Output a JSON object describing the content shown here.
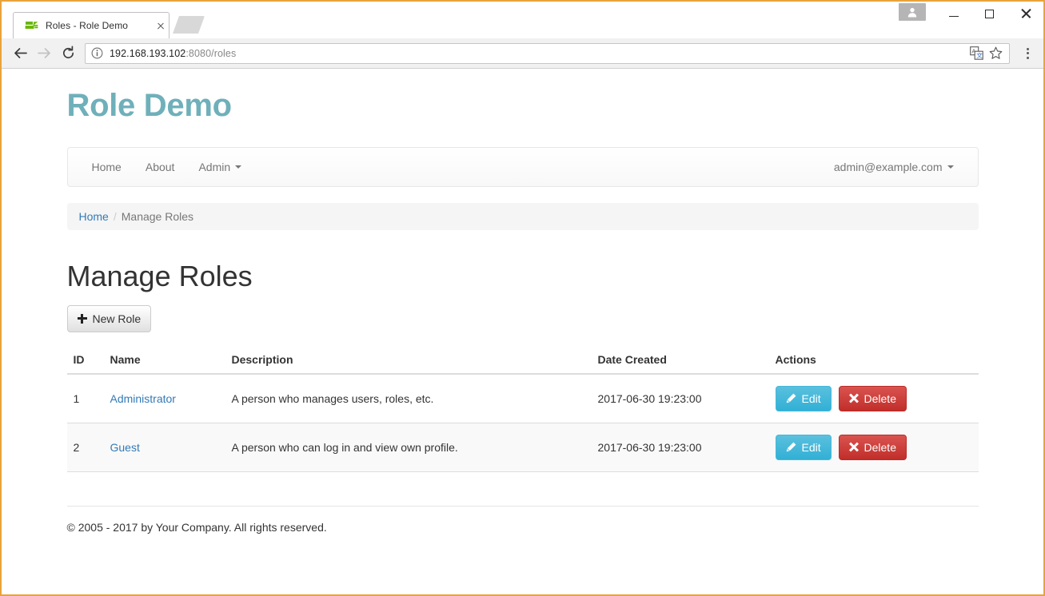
{
  "browser": {
    "tab": {
      "title": "Roles - Role Demo",
      "favicon_name": "zend-framework-favicon",
      "close_label": "Close tab"
    },
    "window_controls": {
      "profile_label": "Profile",
      "minimize_label": "Minimize",
      "maximize_label": "Maximize",
      "close_label": "Close"
    },
    "toolbar": {
      "back_label": "Back",
      "forward_label": "Forward",
      "reload_label": "Reload",
      "site_info_label": "Site information",
      "url_host": "192.168.193.102",
      "url_rest": ":8080/roles",
      "translate_label": "Translate this page",
      "bookmark_label": "Bookmark this page",
      "menu_label": "Customize and control Google Chrome"
    }
  },
  "page": {
    "brand": "Role Demo",
    "navbar": {
      "items": [
        {
          "label": "Home",
          "caret": false
        },
        {
          "label": "About",
          "caret": false
        },
        {
          "label": "Admin",
          "caret": true
        }
      ],
      "user": {
        "label": "admin@example.com",
        "caret": true
      }
    },
    "breadcrumb": {
      "home": "Home",
      "separator": "/",
      "current": "Manage Roles"
    },
    "heading": "Manage Roles",
    "new_role_button": "New Role",
    "table": {
      "headers": [
        "ID",
        "Name",
        "Description",
        "Date Created",
        "Actions"
      ],
      "rows": [
        {
          "id": "1",
          "name": "Administrator",
          "description": "A person who manages users, roles, etc.",
          "date_created": "2017-06-30 19:23:00",
          "edit_label": "Edit",
          "delete_label": "Delete"
        },
        {
          "id": "2",
          "name": "Guest",
          "description": "A person who can log in and view own profile.",
          "date_created": "2017-06-30 19:23:00",
          "edit_label": "Edit",
          "delete_label": "Delete"
        }
      ]
    },
    "footer": "© 2005 - 2017 by Your Company. All rights reserved."
  },
  "colors": {
    "brand_teal": "#6fb0ba",
    "link_blue": "#337ab7",
    "edit_blue": "#5bc0de",
    "delete_red": "#d9534f",
    "window_border": "#e8a33d"
  }
}
